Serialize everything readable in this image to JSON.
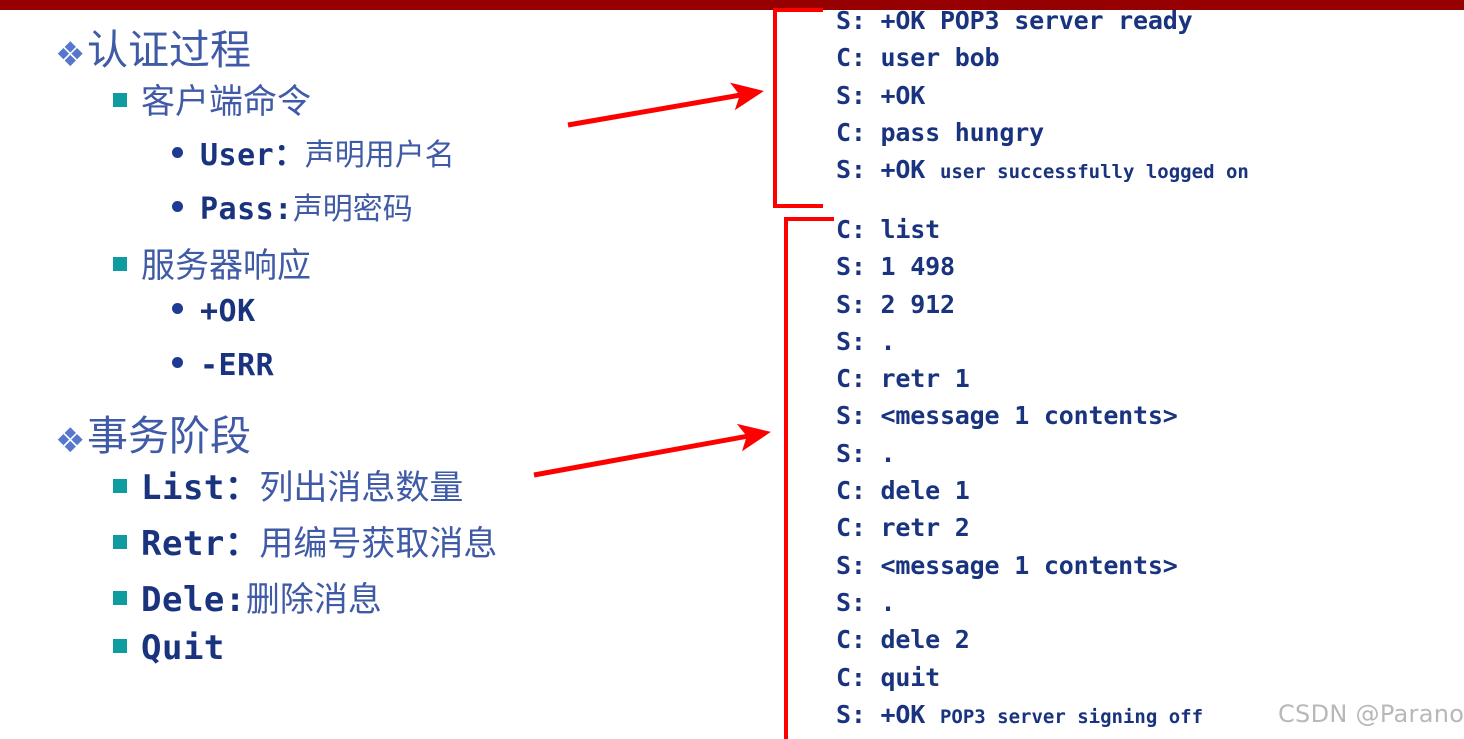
{
  "slide": {
    "top_bar_color": "#970000",
    "background_color": "#ffffff"
  },
  "palette": {
    "accent_red": "#ff0000",
    "band_red": "#970000",
    "heading_navy": "#19337e",
    "cjk_blue": "#3f5aa6",
    "diamond_blue": "#5577cc",
    "square_teal": "#0f9ca0",
    "dot_navy": "#1f3a93",
    "watermark_gray": "#b8b8b8"
  },
  "outline": {
    "sections": [
      {
        "bullet": "diamond-bullet-icon",
        "title": "认证过程",
        "children": [
          {
            "bullet": "square-bullet-icon",
            "title": "客户端命令",
            "children": [
              {
                "bullet": "dot-bullet-icon",
                "code": "User：",
                "desc": "声明用户名"
              },
              {
                "bullet": "dot-bullet-icon",
                "code": "Pass:",
                "desc": "声明密码"
              }
            ]
          },
          {
            "bullet": "square-bullet-icon",
            "title": "服务器响应",
            "children": [
              {
                "bullet": "dot-bullet-icon",
                "code": "+OK",
                "desc": ""
              },
              {
                "bullet": "dot-bullet-icon",
                "code": "-ERR",
                "desc": ""
              }
            ]
          }
        ]
      },
      {
        "bullet": "diamond-bullet-icon",
        "title": "事务阶段",
        "children": [
          {
            "bullet": "square-bullet-icon",
            "code": "List：",
            "desc": "列出消息数量"
          },
          {
            "bullet": "square-bullet-icon",
            "code": "Retr：",
            "desc": "用编号获取消息"
          },
          {
            "bullet": "square-bullet-icon",
            "code": "Dele:",
            "desc": "删除消息"
          },
          {
            "bullet": "square-bullet-icon",
            "code": "Quit",
            "desc": ""
          }
        ]
      }
    ],
    "flat": {
      "s1_title": "认证过程",
      "s1_c1_title": "客户端命令",
      "s1_c1_i1_code": "User：",
      "s1_c1_i1_desc": "声明用户名",
      "s1_c1_i2_code": "Pass:",
      "s1_c1_i2_desc": "声明密码",
      "s1_c2_title": "服务器响应",
      "s1_c2_i1_code": "+OK",
      "s1_c2_i2_code": "-ERR",
      "s2_title": "事务阶段",
      "s2_i1_code": "List：",
      "s2_i1_desc": "列出消息数量",
      "s2_i2_code": "Retr：",
      "s2_i2_desc": "用编号获取消息",
      "s2_i3_code": "Dele:",
      "s2_i3_desc": "删除消息",
      "s2_i4_code": "Quit"
    }
  },
  "transcript": {
    "auth_block": {
      "lines": [
        {
          "big": "S: +OK POP3 server ready",
          "small": ""
        },
        {
          "big": "C: user bob",
          "small": ""
        },
        {
          "big": "S: +OK",
          "small": ""
        },
        {
          "big": "C: pass hungry",
          "small": ""
        },
        {
          "big": "S: +OK ",
          "small": "user successfully logged on"
        }
      ],
      "flat": {
        "l1": "S: +OK POP3 server ready",
        "l2": "C: user bob",
        "l3": "S: +OK",
        "l4": "C: pass hungry",
        "l5_big": "S: +OK ",
        "l5_small": "user successfully logged on"
      }
    },
    "transaction_block": {
      "lines": [
        {
          "big": "C: list",
          "small": ""
        },
        {
          "big": "S: 1 498",
          "small": ""
        },
        {
          "big": "S: 2 912",
          "small": ""
        },
        {
          "big": "S: .",
          "small": ""
        },
        {
          "big": "C: retr 1",
          "small": ""
        },
        {
          "big": "S: <message 1 contents>",
          "small": ""
        },
        {
          "big": "S: .",
          "small": ""
        },
        {
          "big": "C: dele 1",
          "small": ""
        },
        {
          "big": "C: retr 2",
          "small": ""
        },
        {
          "big": "S: <message 1 contents>",
          "small": ""
        },
        {
          "big": "S: .",
          "small": ""
        },
        {
          "big": "C: dele 2",
          "small": ""
        },
        {
          "big": "C: quit",
          "small": ""
        },
        {
          "big": "S: +OK ",
          "small": "POP3 server signing off"
        }
      ],
      "flat": {
        "l1": "C: list",
        "l2": "S: 1 498",
        "l3": "S: 2 912",
        "l4": "S: .",
        "l5": "C: retr 1",
        "l6": "S: <message 1 contents>",
        "l7": "S: .",
        "l8": "C: dele 1",
        "l9": "C: retr 2",
        "l10": "S: <message 1 contents>",
        "l11": "S: .",
        "l12": "C: dele 2",
        "l13": "C: quit",
        "l14_big": "S: +OK ",
        "l14_small": "POP3 server signing off"
      }
    }
  },
  "watermark": {
    "text": "CSDN @Paranoid☆"
  }
}
